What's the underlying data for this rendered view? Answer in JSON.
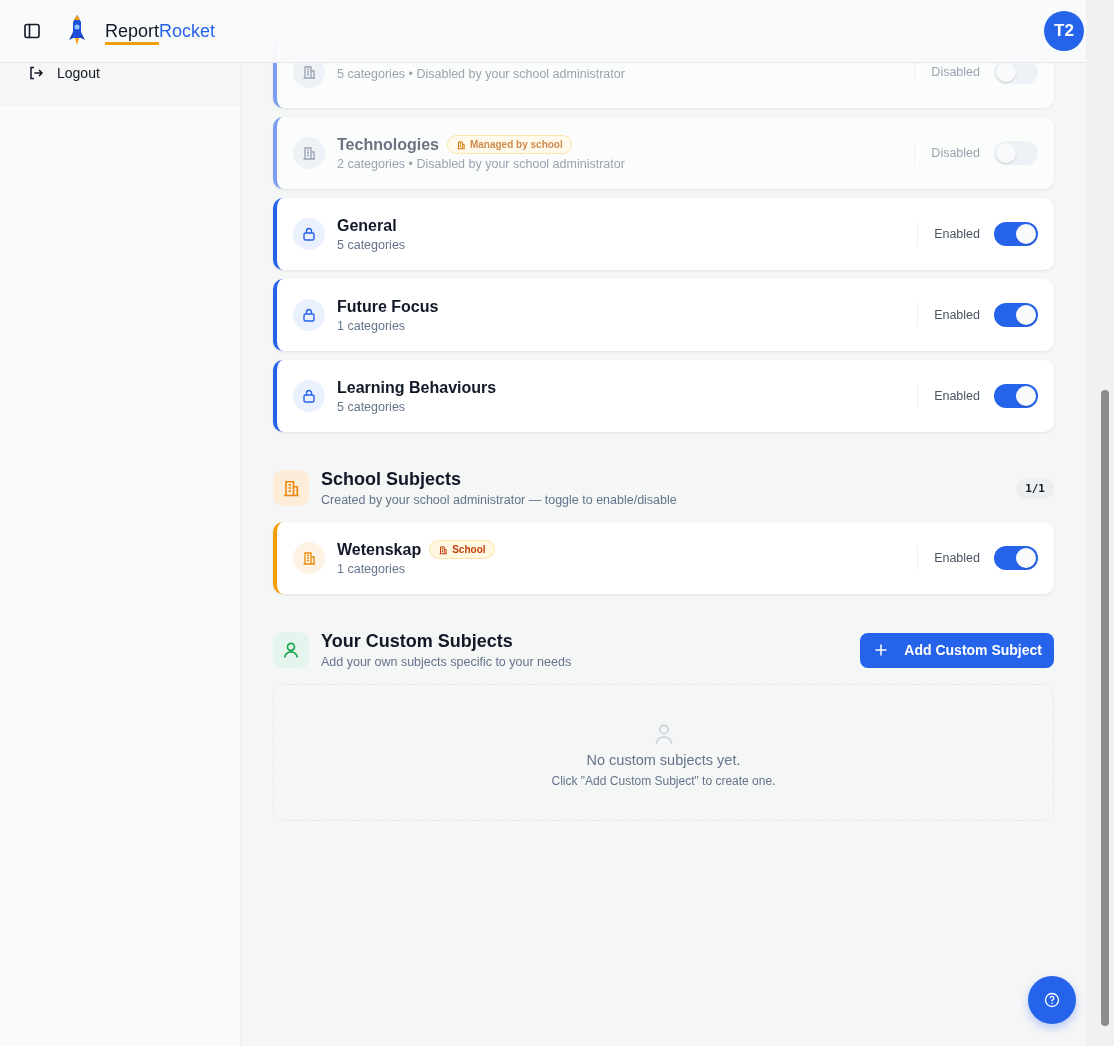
{
  "header": {
    "brand_dark": "Report",
    "brand_accent": "Rocket",
    "avatar": "T2"
  },
  "sidebar": {
    "items": [
      {
        "label": "Logout"
      }
    ]
  },
  "subjects": [
    {
      "kind": "managed",
      "meta": "5 categories • Disabled by your school administrator",
      "status": "Disabled",
      "on": false,
      "disabled": true
    },
    {
      "kind": "managed",
      "name": "Technologies",
      "badge": "Managed by school",
      "meta": "2 categories • Disabled by your school administrator",
      "status": "Disabled",
      "on": false,
      "disabled": true
    },
    {
      "kind": "locked",
      "name": "General",
      "meta": "5 categories",
      "status": "Enabled",
      "on": true,
      "disabled": false
    },
    {
      "kind": "locked",
      "name": "Future Focus",
      "meta": "1 categories",
      "status": "Enabled",
      "on": true,
      "disabled": false
    },
    {
      "kind": "locked",
      "name": "Learning Behaviours",
      "meta": "5 categories",
      "status": "Enabled",
      "on": true,
      "disabled": false
    }
  ],
  "school_section": {
    "title": "School Subjects",
    "subtitle": "Created by your school administrator — toggle to enable/disable",
    "count": "1/1",
    "subjects": [
      {
        "kind": "school",
        "name": "Wetenskap",
        "badge": "School",
        "meta": "1 categories",
        "status": "Enabled",
        "on": true,
        "disabled": false
      }
    ]
  },
  "custom_section": {
    "title": "Your Custom Subjects",
    "subtitle": "Add your own subjects specific to your needs",
    "button": "Add Custom Subject",
    "empty_title": "No custom subjects yet.",
    "empty_hint": "Click \"Add Custom Subject\" to create one."
  }
}
